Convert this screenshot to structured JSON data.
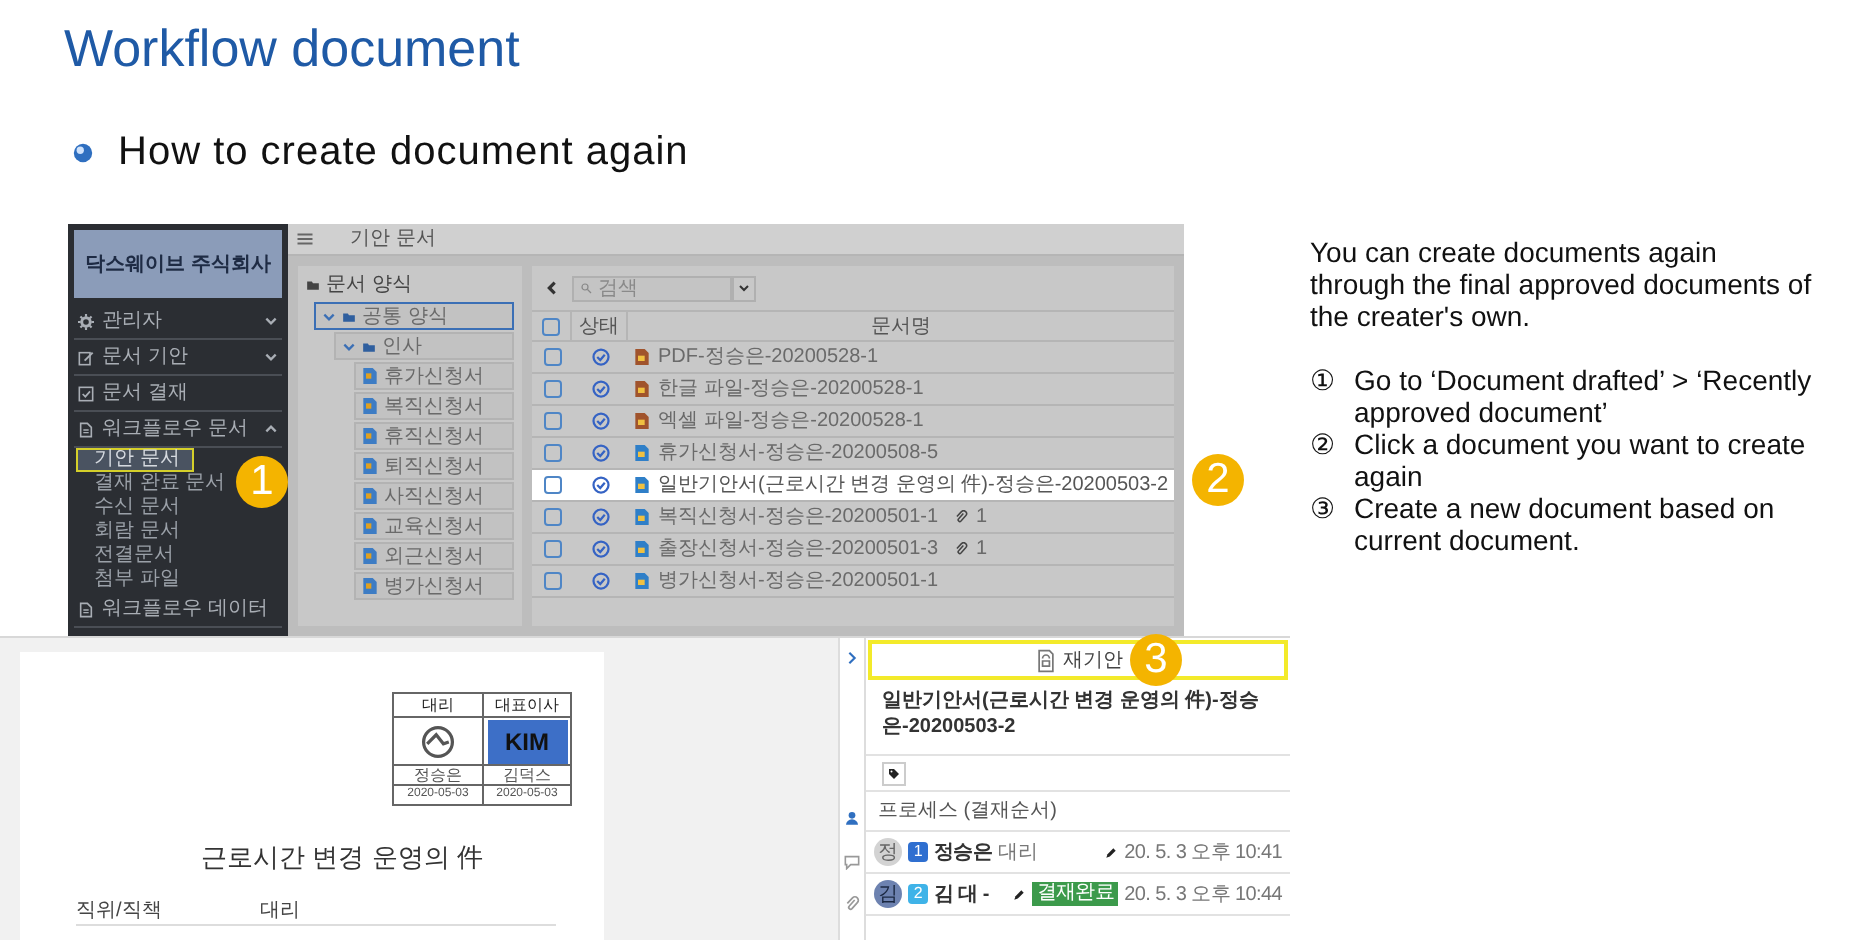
{
  "slide": {
    "title": "Workflow document",
    "subtitle": "How to create document again"
  },
  "app_screenshot": {
    "callouts": [
      "1",
      "2"
    ],
    "sidebar": {
      "company": "닥스웨이브 주식회사",
      "items": [
        {
          "label": "관리자",
          "expanded": false
        },
        {
          "label": "문서 기안",
          "expanded": false
        },
        {
          "label": "문서 결재"
        },
        {
          "label": "워크플로우 문서",
          "expanded": true,
          "children": [
            {
              "label": "기안 문서",
              "selected": true
            },
            {
              "label": "결재 완료 문서",
              "selected": false
            },
            {
              "label": "수신 문서",
              "selected": false
            },
            {
              "label": "회람 문서",
              "selected": false
            },
            {
              "label": "전결문서",
              "selected": false
            },
            {
              "label": "첨부 파일",
              "selected": false
            }
          ]
        },
        {
          "label": "워크플로우 데이터"
        }
      ]
    },
    "page_title": "기안 문서",
    "forms_panel": {
      "title": "문서 양식",
      "tree": [
        {
          "label": "공통 양식",
          "selected": true,
          "expanded": true,
          "children": [
            {
              "label": "인사",
              "selected": false,
              "expanded": true,
              "children": [
                {
                  "label": "휴가신청서",
                  "selected": false
                },
                {
                  "label": "복직신청서",
                  "selected": false
                },
                {
                  "label": "휴직신청서",
                  "selected": false
                },
                {
                  "label": "퇴직신청서",
                  "selected": false
                },
                {
                  "label": "사직신청서",
                  "selected": false
                },
                {
                  "label": "교육신청서",
                  "selected": false
                },
                {
                  "label": "외근신청서",
                  "selected": false
                },
                {
                  "label": "병가신청서",
                  "selected": false
                }
              ]
            }
          ]
        }
      ]
    },
    "document_list": {
      "search_placeholder": "검색",
      "select_all_checked": false,
      "columns": [
        "상태",
        "문서명"
      ],
      "rows": [
        {
          "name": "PDF-정승은-20200528-1",
          "kind": "file",
          "checked": false,
          "selected": false
        },
        {
          "name": "한글 파일-정승은-20200528-1",
          "kind": "file",
          "checked": false,
          "selected": false
        },
        {
          "name": "엑셀 파일-정승은-20200528-1",
          "kind": "file",
          "checked": false,
          "selected": false
        },
        {
          "name": "휴가신청서-정승은-20200508-5",
          "kind": "form",
          "checked": false,
          "selected": false
        },
        {
          "name": "일반기안서(근로시간 변경 운영의 件)-정승은-20200503-2",
          "kind": "form",
          "checked": false,
          "selected": true
        },
        {
          "name": "복직신청서-정승은-20200501-1",
          "kind": "form",
          "checked": false,
          "selected": false,
          "attachments": "1"
        },
        {
          "name": "출장신청서-정승은-20200501-3",
          "kind": "form",
          "checked": false,
          "selected": false,
          "attachments": "1"
        },
        {
          "name": "병가신청서-정승은-20200501-1",
          "kind": "form",
          "checked": false,
          "selected": false
        }
      ]
    }
  },
  "document_screenshot": {
    "callout": "3",
    "approval_stamp": [
      {
        "role": "대리",
        "kind": "seal",
        "name": "정승은",
        "date": "2020-05-03"
      },
      {
        "role": "대표이사",
        "kind": "initials",
        "mark": "KIM",
        "name": "김덕스",
        "date": "2020-05-03"
      }
    ],
    "document_title": "근로시간 변경 운영의 件",
    "fields": [
      {
        "label": "직위/직책",
        "value": "대리"
      }
    ],
    "side_panel": {
      "button": "재기안",
      "title": "일반기안서(근로시간 변경 운영의 件)-정승은-20200503-2",
      "process_label": "프로세스 (결재순서)",
      "approvers": [
        {
          "avatar": "정",
          "order": "1",
          "name": "정승은",
          "position": "대리",
          "time": "20. 5. 3 오후 10:41"
        },
        {
          "avatar": "김",
          "order": "2",
          "name": "김 대 -",
          "status": "결재완료",
          "time": "20. 5. 3 오후 10:44"
        }
      ]
    }
  },
  "instructions": {
    "intro": "You can create documents again through the final approved documents of the creater's own.",
    "steps": [
      {
        "marker": "①",
        "text": "Go to ‘Document drafted’ > ‘Recently approved document’"
      },
      {
        "marker": "②",
        "text": "Click a document you want to create again"
      },
      {
        "marker": "③",
        "text": "Create a new document based on current document."
      }
    ]
  }
}
